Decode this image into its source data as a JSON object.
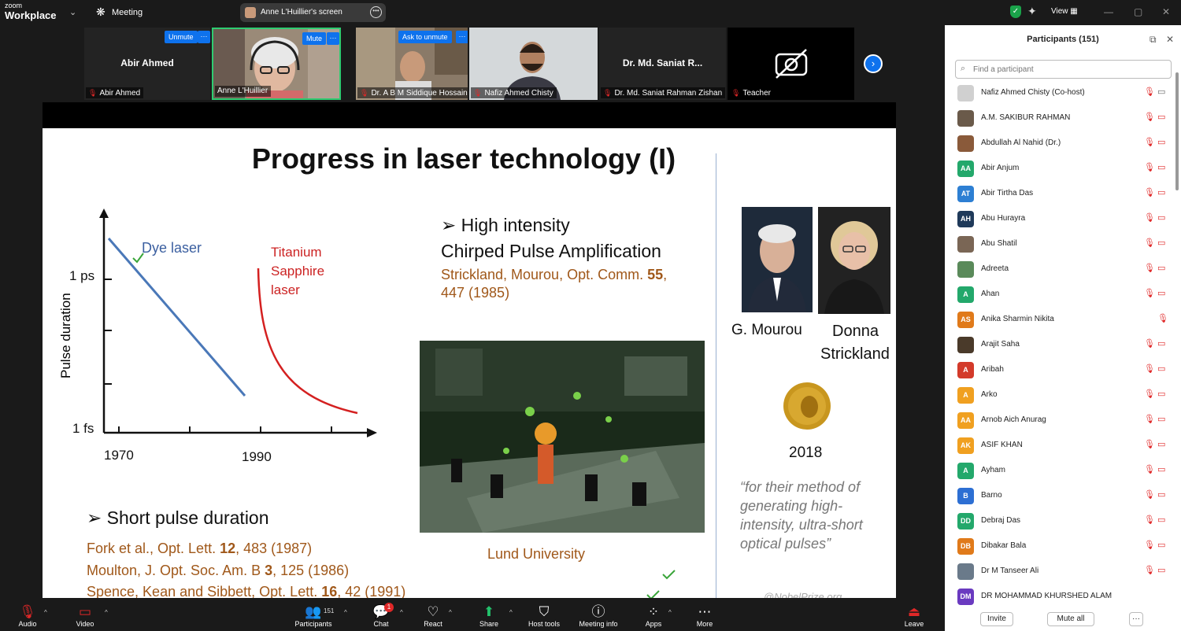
{
  "topbar": {
    "brand_small": "zoom",
    "brand_big": "Workplace",
    "meeting_label": "Meeting",
    "share_title": "Anne L'Huillier's screen",
    "view_label": "View"
  },
  "tiles": {
    "t1": {
      "center_name": "Abir Ahmed",
      "label": "Abir Ahmed",
      "btn": "Unmute"
    },
    "t2": {
      "label": "Anne L'Huillier",
      "btn": "Mute"
    },
    "t3": {
      "label": "Dr. A B M Siddique Hossain",
      "btn": "Ask to unmute"
    },
    "t4": {
      "label": "Nafiz Ahmed Chisty"
    },
    "t5": {
      "center_name": "Dr. Md. Saniat R...",
      "label": "Dr. Md. Saniat Rahman Zishan"
    },
    "t6": {
      "label": "Teacher"
    }
  },
  "slide": {
    "title": "Progress in laser technology (I)",
    "axis_y": "Pulse duration",
    "tick_1ps": "1 ps",
    "tick_1fs": "1 fs",
    "year_1970": "1970",
    "year_1990": "1990",
    "dye": "Dye laser",
    "ti_1": "Titanium",
    "ti_2": "Sapphire",
    "ti_3": "laser",
    "hi_head": "➢ High intensity",
    "cpa": "Chirped Pulse Amplification",
    "ref_s1a": "Strickland, Mourou, Opt. Comm. ",
    "ref_s1b": "55",
    "ref_s1c": ",",
    "ref_s2": "447 (1985)",
    "lund": "Lund University",
    "spd_head": "➢ Short pulse duration",
    "r1a": "Fork et al., Opt. Lett.  ",
    "r1b": "12",
    "r1c": ", 483 (1987)",
    "r2a": "Moulton, J. Opt. Soc. Am. B ",
    "r2b": "3",
    "r2c": ", 125 (1986)",
    "r3a": "Spence, Kean and Sibbett, Opt. Lett. ",
    "r3b": "16",
    "r3c": ", 42 (1991)",
    "mourou": "G. Mourou",
    "donna_1": "Donna",
    "donna_2": "Strickland",
    "year": "2018",
    "q1": "“for their method of",
    "q2": "generating high-",
    "q3": "intensity, ultra-short",
    "q4": "optical pulses”",
    "credit": "@NobelPrize.org"
  },
  "panel": {
    "title": "Participants (151)",
    "search_placeholder": "Find a participant",
    "invite": "Invite",
    "mute_all": "Mute all",
    "participants": [
      {
        "name": "Nafiz Ahmed Chisty (Co-host)",
        "initials": "",
        "color": "#d0d0d0"
      },
      {
        "name": "A.M. SAKIBUR RAHMAN",
        "initials": "",
        "color": "#6a5a4a"
      },
      {
        "name": "Abdullah Al Nahid (Dr.)",
        "initials": "",
        "color": "#8a5a3a"
      },
      {
        "name": "Abir Anjum",
        "initials": "AA",
        "color": "#23a86b"
      },
      {
        "name": "Abir Tirtha Das",
        "initials": "AT",
        "color": "#2d7fd3"
      },
      {
        "name": "Abu Hurayra",
        "initials": "AH",
        "color": "#1f3a5a"
      },
      {
        "name": "Abu Shatil",
        "initials": "",
        "color": "#7a6655"
      },
      {
        "name": "Adreeta",
        "initials": "",
        "color": "#5a8a5a"
      },
      {
        "name": "Ahan",
        "initials": "A",
        "color": "#23a86b"
      },
      {
        "name": "Anika Sharmin Nikita",
        "initials": "AS",
        "color": "#e07a1a"
      },
      {
        "name": "Arajit Saha",
        "initials": "",
        "color": "#4a3a2a"
      },
      {
        "name": "Aribah",
        "initials": "A",
        "color": "#d33a2a"
      },
      {
        "name": "Arko",
        "initials": "A",
        "color": "#f0a020"
      },
      {
        "name": "Arnob Aich Anurag",
        "initials": "AA",
        "color": "#f0a020"
      },
      {
        "name": "ASIF KHAN",
        "initials": "AK",
        "color": "#f0a020"
      },
      {
        "name": "Ayham",
        "initials": "A",
        "color": "#23a86b"
      },
      {
        "name": "Barno",
        "initials": "B",
        "color": "#2d6fd3"
      },
      {
        "name": "Debraj Das",
        "initials": "DD",
        "color": "#23a86b"
      },
      {
        "name": "Dibakar Bala",
        "initials": "DB",
        "color": "#e07a1a"
      },
      {
        "name": "Dr M Tanseer Ali",
        "initials": "",
        "color": "#6a7a8a"
      },
      {
        "name": "DR MOHAMMAD KHURSHED ALAM",
        "initials": "DM",
        "color": "#6a3ac0"
      }
    ]
  },
  "toolbar": {
    "audio": "Audio",
    "video": "Video",
    "participants": "Participants",
    "participants_count": "151",
    "chat": "Chat",
    "chat_badge": "1",
    "react": "React",
    "share": "Share",
    "host_tools": "Host tools",
    "meeting_info": "Meeting info",
    "apps": "Apps",
    "more": "More",
    "leave": "Leave"
  }
}
